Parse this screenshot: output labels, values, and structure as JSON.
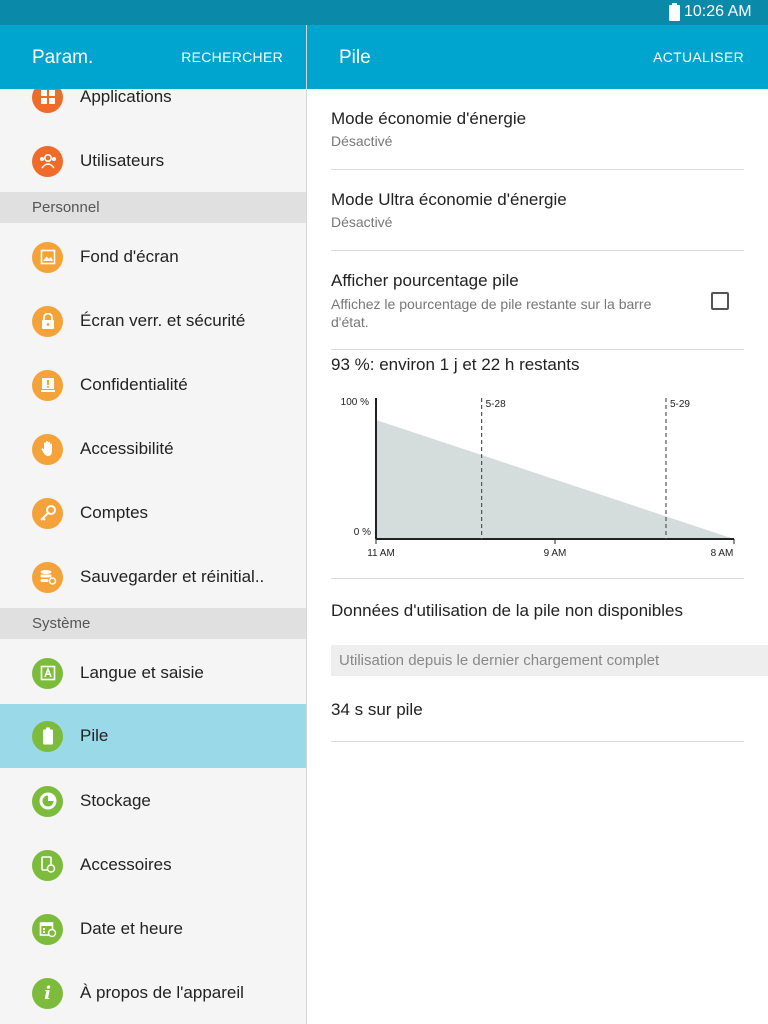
{
  "status_bar": {
    "time": "10:26 AM"
  },
  "left_header": {
    "title": "Param.",
    "action": "RECHERCHER"
  },
  "right_header": {
    "title": "Pile",
    "action": "ACTUALISER"
  },
  "sidebar": {
    "items_top": [
      {
        "label": "Applications",
        "icon": "apps-grid-icon",
        "color": "#ef6b2a"
      },
      {
        "label": "Utilisateurs",
        "icon": "users-icon",
        "color": "#ef6b2a"
      }
    ],
    "section_personnel": "Personnel",
    "items_personnel": [
      {
        "label": "Fond d'écran",
        "icon": "wallpaper-icon",
        "color": "#f3a33a"
      },
      {
        "label": "Écran verr. et sécurité",
        "icon": "lock-icon",
        "color": "#f3a33a"
      },
      {
        "label": "Confidentialité",
        "icon": "privacy-icon",
        "color": "#f3a33a"
      },
      {
        "label": "Accessibilité",
        "icon": "hand-icon",
        "color": "#f3a33a"
      },
      {
        "label": "Comptes",
        "icon": "key-icon",
        "color": "#f3a33a"
      },
      {
        "label": "Sauvegarder et réinitial..",
        "icon": "backup-icon",
        "color": "#f3a33a"
      }
    ],
    "section_systeme": "Système",
    "items_systeme": [
      {
        "label": "Langue et saisie",
        "icon": "language-icon",
        "color": "#7dbb3d"
      },
      {
        "label": "Pile",
        "icon": "battery-icon",
        "color": "#7dbb3d",
        "selected": true
      },
      {
        "label": "Stockage",
        "icon": "storage-icon",
        "color": "#7dbb3d"
      },
      {
        "label": "Accessoires",
        "icon": "accessories-icon",
        "color": "#7dbb3d"
      },
      {
        "label": "Date et heure",
        "icon": "calendar-icon",
        "color": "#7dbb3d"
      },
      {
        "label": "À propos de l'appareil",
        "icon": "info-icon",
        "color": "#7dbb3d"
      }
    ]
  },
  "main": {
    "power_saving": {
      "title": "Mode économie d'énergie",
      "state": "Désactivé"
    },
    "ultra_power_saving": {
      "title": "Mode Ultra économie d'énergie",
      "state": "Désactivé"
    },
    "show_percentage": {
      "title": "Afficher pourcentage pile",
      "description": "Affichez le pourcentage de pile restante sur la barre d'état.",
      "checked": false
    },
    "estimate": "93 %: environ 1 j et 22 h restants",
    "usage_unavailable": "Données d'utilisation de la pile non disponibles",
    "since_full_charge_header": "Utilisation depuis le dernier chargement complet",
    "on_battery": "34 s sur pile"
  },
  "chart_data": {
    "type": "area",
    "y_tick_labels": [
      "100 %",
      "0 %"
    ],
    "x_tick_labels": [
      "11 AM",
      "9 AM",
      "8 AM"
    ],
    "x_tick_positions": [
      0,
      0.5,
      1
    ],
    "day_markers": [
      {
        "label": "5-28",
        "x": 0.295
      },
      {
        "label": "5-29",
        "x": 0.81
      }
    ],
    "x": [
      0,
      1
    ],
    "values": [
      93,
      0
    ],
    "ylim": [
      0,
      100
    ],
    "xlim": [
      0,
      1
    ],
    "fill_color": "#d5dcdc",
    "grid": false
  }
}
